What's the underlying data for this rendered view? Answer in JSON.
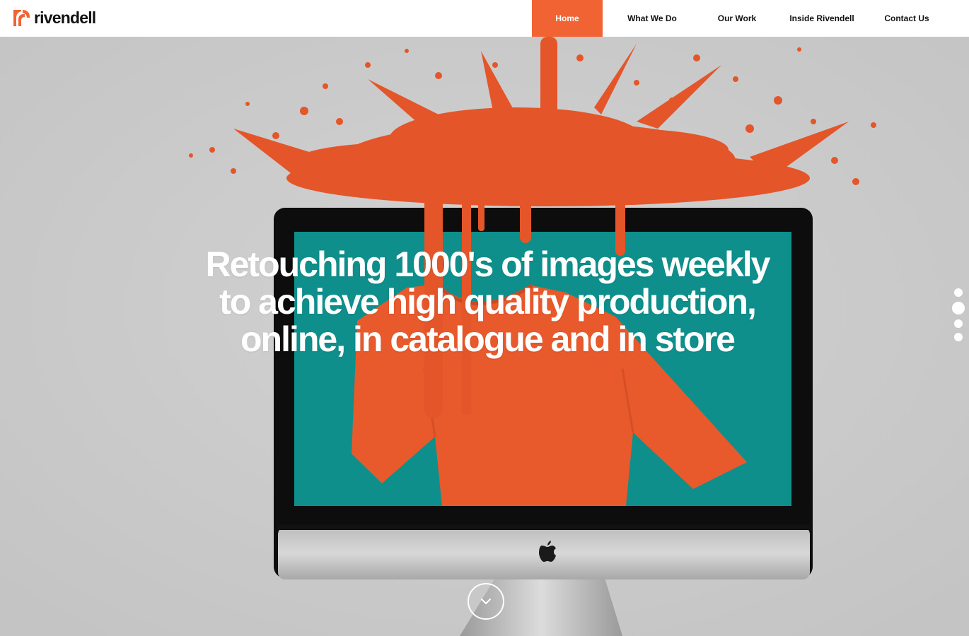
{
  "brand": {
    "name": "rivendell",
    "accent_color": "#f26334",
    "logo_icon": "rivendell-mark-icon"
  },
  "nav": {
    "items": [
      {
        "label": "Home",
        "active": true
      },
      {
        "label": "What We Do",
        "active": false
      },
      {
        "label": "Our Work",
        "active": false
      },
      {
        "label": "Inside Rivendell",
        "active": false
      },
      {
        "label": "Contact Us",
        "active": false
      }
    ]
  },
  "hero": {
    "headline_line1": "Retouching 1000's of images weekly",
    "headline_line2": "to achieve high quality production,",
    "headline_line3": "online, in catalogue and in store",
    "slide_count": 4,
    "active_slide": 2,
    "scroll_icon": "chevron-down-icon",
    "screen_color": "#0f8f8c",
    "paint_color": "#e4562a"
  }
}
